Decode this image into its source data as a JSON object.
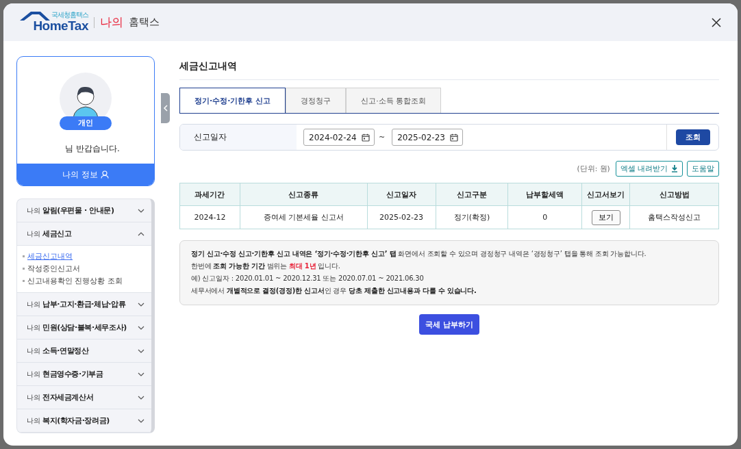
{
  "header": {
    "logo_subtitle": "국세청홈택스",
    "logo_text": "HomeTax",
    "brand_highlight": "나의",
    "brand_text": "홈택스"
  },
  "profile": {
    "badge": "개인",
    "greeting": "님 반갑습니다.",
    "info_button": "나의 정보"
  },
  "menu": [
    {
      "prefix": "나의",
      "label": "알림(우편물 · 안내문)",
      "expanded": false
    },
    {
      "prefix": "나의",
      "label": "세금신고",
      "expanded": true,
      "children": [
        {
          "label": "세금신고내역",
          "selected": true
        },
        {
          "label": "작성중인신고서",
          "selected": false
        },
        {
          "label": "신고내용확인 진행상황 조회",
          "selected": false
        }
      ]
    },
    {
      "prefix": "나의",
      "label": "납부·고지·환급·체납·압류",
      "expanded": false
    },
    {
      "prefix": "나의",
      "label": "민원(상담·불복·세무조사)",
      "expanded": false
    },
    {
      "prefix": "나의",
      "label": "소득·연말정산",
      "expanded": false
    },
    {
      "prefix": "나의",
      "label": "현금영수증·기부금",
      "expanded": false
    },
    {
      "prefix": "나의",
      "label": "전자세금계산서",
      "expanded": false
    },
    {
      "prefix": "나의",
      "label": "복지(학자금·장려금)",
      "expanded": false
    }
  ],
  "page_title": "세금신고내역",
  "tabs": [
    {
      "label": "정기·수정·기한후 신고",
      "selected": true
    },
    {
      "label": "경정청구",
      "selected": false
    },
    {
      "label": "신고·소득 통합조회",
      "selected": false
    }
  ],
  "filter": {
    "label": "신고일자",
    "from": "2024-02-24",
    "separator": "~",
    "to": "2025-02-23",
    "button": "조회"
  },
  "unit": "(단위: 원)",
  "excel_button": "엑셀 내려받기",
  "help_button": "도움말",
  "table": {
    "columns": [
      "과세기간",
      "신고종류",
      "신고일자",
      "신고구분",
      "납부할세액",
      "신고서보기",
      "신고방법"
    ],
    "rows": [
      [
        {
          "kind": "text",
          "text": "2024-12"
        },
        {
          "kind": "text",
          "text": "증여세 기본세율 신고서"
        },
        {
          "kind": "text",
          "text": "2025-02-23"
        },
        {
          "kind": "text",
          "text": "정기(확정)"
        },
        {
          "kind": "text",
          "text": "0"
        },
        {
          "kind": "button",
          "text": "보기"
        },
        {
          "kind": "text",
          "text": "홈택스작성신고"
        }
      ]
    ]
  },
  "notes": [
    [
      {
        "kind": "bold",
        "text": "정기 신고·수정 신고·기한후 신고 내역은 ‘정기·수정·기한후 신고’ 탭"
      },
      {
        "kind": "normal",
        "text": " 화면에서 조회할 수 있으며 경정청구 내역은  ‘경정청구’ 탭을 통해 조회 가능합니다."
      }
    ],
    [
      {
        "kind": "normal",
        "text": "한번에 "
      },
      {
        "kind": "bold",
        "text": "조회 가능한 기간"
      },
      {
        "kind": "normal",
        "text": " 범위는 "
      },
      {
        "kind": "red",
        "text": "최대 1년"
      },
      {
        "kind": "normal",
        "text": " 입니다."
      }
    ],
    [
      {
        "kind": "normal",
        "text": "예) 신고일자 : 2020.01.01 ~ 2020.12.31 또는 2020.07.01 ~ 2021.06.30"
      }
    ],
    [
      {
        "kind": "normal",
        "text": "세무서에서 "
      },
      {
        "kind": "bold",
        "text": "개별적으로 결정(경정)한 신고서"
      },
      {
        "kind": "normal",
        "text": "인 경우 "
      },
      {
        "kind": "bold",
        "text": "당초 제출한 신고내용과 다를 수 있습니다."
      }
    ]
  ],
  "pay_button": "국세 납부하기"
}
